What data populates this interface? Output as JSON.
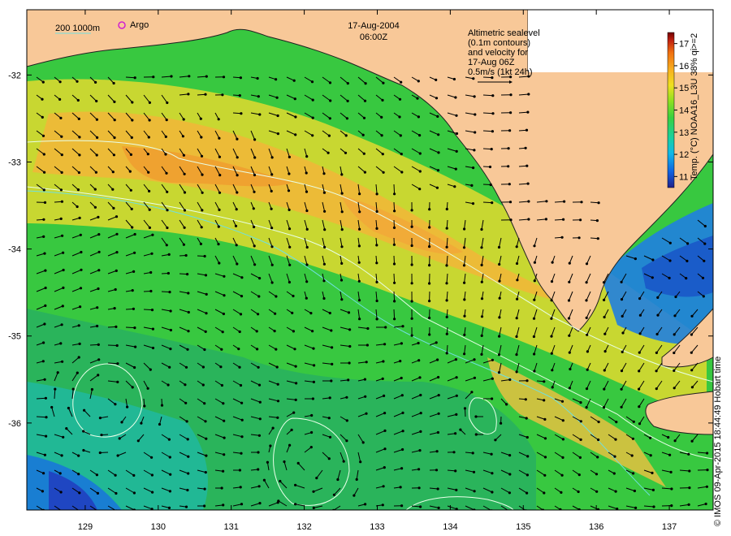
{
  "title": {
    "date": "17-Aug-2004",
    "time": "06:00Z"
  },
  "scale_legend": {
    "depth_labels": "200  1000m",
    "argo_label": "Argo",
    "argo_marker_color": "#d020d0",
    "contour_color_200m": "#6fe0e0"
  },
  "velocity_note": {
    "lines": [
      "Altimetric sealevel",
      "(0.1m contours)",
      "and velocity for",
      "17-Aug 06Z",
      "0.5m/s (1kt 24h)"
    ]
  },
  "colorbar": {
    "label": "Temp. (°C) NOAA16_L3U 38% qi>=2",
    "ticks": [
      "11",
      "12",
      "13",
      "14",
      "15",
      "16",
      "17"
    ],
    "min": 10.5,
    "max": 17.5,
    "colors": [
      "#20208a",
      "#1060e0",
      "#10b8e8",
      "#18d0a0",
      "#38d040",
      "#90e020",
      "#f0e020",
      "#f8b020",
      "#f07010",
      "#c02010",
      "#700000"
    ]
  },
  "axes": {
    "lon_ticks": [
      "129",
      "130",
      "131",
      "132",
      "133",
      "134",
      "135",
      "136",
      "137"
    ],
    "lat_ticks": [
      "-32",
      "-33",
      "-34",
      "-35",
      "-36"
    ],
    "lon_range": [
      128.2,
      137.6
    ],
    "lat_range": [
      -37.0,
      -31.25
    ]
  },
  "land_color": "#f8c898",
  "credit": "© IMOS 09-Apr-2015 18:44:49 Hobart time"
}
